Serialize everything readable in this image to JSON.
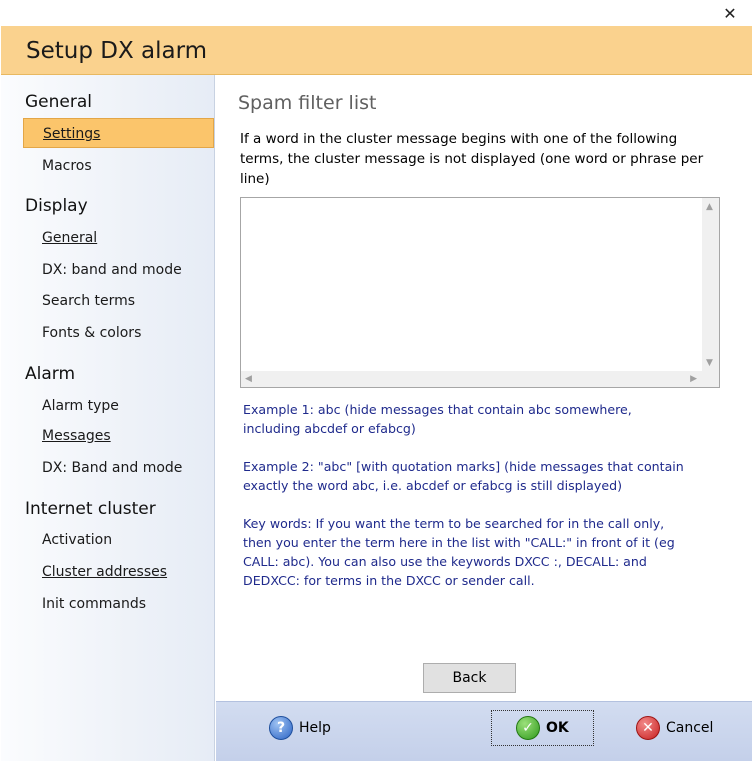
{
  "window": {
    "close_glyph": "✕"
  },
  "header": {
    "title": "Setup DX alarm"
  },
  "sidebar": {
    "groups": [
      {
        "label": "General",
        "items": [
          {
            "label": "Settings",
            "active": true
          },
          {
            "label": "Macros",
            "active": false
          }
        ]
      },
      {
        "label": "Display",
        "items": [
          {
            "label": "General",
            "active": false
          },
          {
            "label": "DX: band and mode",
            "active": false
          },
          {
            "label": "Search terms",
            "active": false
          },
          {
            "label": "Fonts & colors",
            "active": false
          }
        ]
      },
      {
        "label": "Alarm",
        "items": [
          {
            "label": "Alarm type",
            "active": false
          },
          {
            "label": "Messages",
            "active": false
          },
          {
            "label": "DX: Band and mode",
            "active": false
          }
        ]
      },
      {
        "label": "Internet cluster",
        "items": [
          {
            "label": "Activation",
            "active": false
          },
          {
            "label": "Cluster addresses",
            "active": false
          },
          {
            "label": "Init commands",
            "active": false
          }
        ]
      }
    ]
  },
  "main": {
    "section_title": "Spam filter list",
    "description": "If a word in the cluster message begins with one of the following terms, the cluster message is not displayed (one word or phrase per line)",
    "filter_list_value": "",
    "example1": "Example 1: abc (hide messages that contain abc somewhere, including abcdef or efabcg)",
    "example2": "Example 2: \"abc\" [with quotation marks] (hide messages that contain exactly the word abc, i.e. abcdef or efabcg is still displayed)",
    "keywords": "Key words: If you want the term to be searched for in the call only, then you enter the term here in the list with \"CALL:\" in front of it (eg CALL: abc). You can also use the keywords DXCC :, DECALL: and DEDXCC: for terms in the DXCC or sender call.",
    "back_label": "Back"
  },
  "footer": {
    "help_label": "Help",
    "ok_label": "OK",
    "cancel_label": "Cancel"
  },
  "colors": {
    "header_bg": "#fad28e",
    "active_item_bg": "#fbc56b",
    "example_text": "#1f2a8c",
    "footer_bg": "#c8d4ec"
  },
  "icons": {
    "help": "help-question-icon",
    "ok": "check-icon",
    "cancel": "cancel-x-icon",
    "close": "close-icon"
  }
}
